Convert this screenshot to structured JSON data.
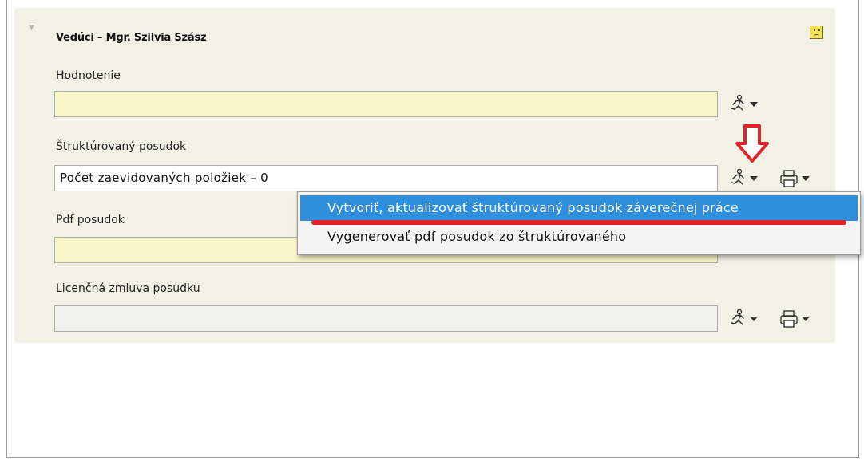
{
  "section": {
    "title": "Vedúci – Mgr. Szilvia Szász",
    "collapse_icon": "triangle-down-icon",
    "status_icon": "sad-face-icon"
  },
  "fields": [
    {
      "label": "Hodnotenie",
      "value": ""
    },
    {
      "label": "Štruktúrovaný posudok",
      "value": "Počet zaevidovaných položiek – 0"
    },
    {
      "label": "Pdf posudok",
      "value": ""
    },
    {
      "label": "Licenčná zmluva posudku",
      "value": ""
    }
  ],
  "context_menu": {
    "items": [
      {
        "label": "Vytvoriť, aktualizovať štruktúrovaný posudok záverečnej práce",
        "highlighted": true
      },
      {
        "label": "Vygenerovať pdf posudok zo štruktúrovaného",
        "highlighted": false
      }
    ]
  },
  "colors": {
    "highlight": "#2f8fdc",
    "annotation_red": "#e2242a",
    "field_yellow": "#f7f5c8",
    "panel_bg": "#f1f1e6"
  }
}
